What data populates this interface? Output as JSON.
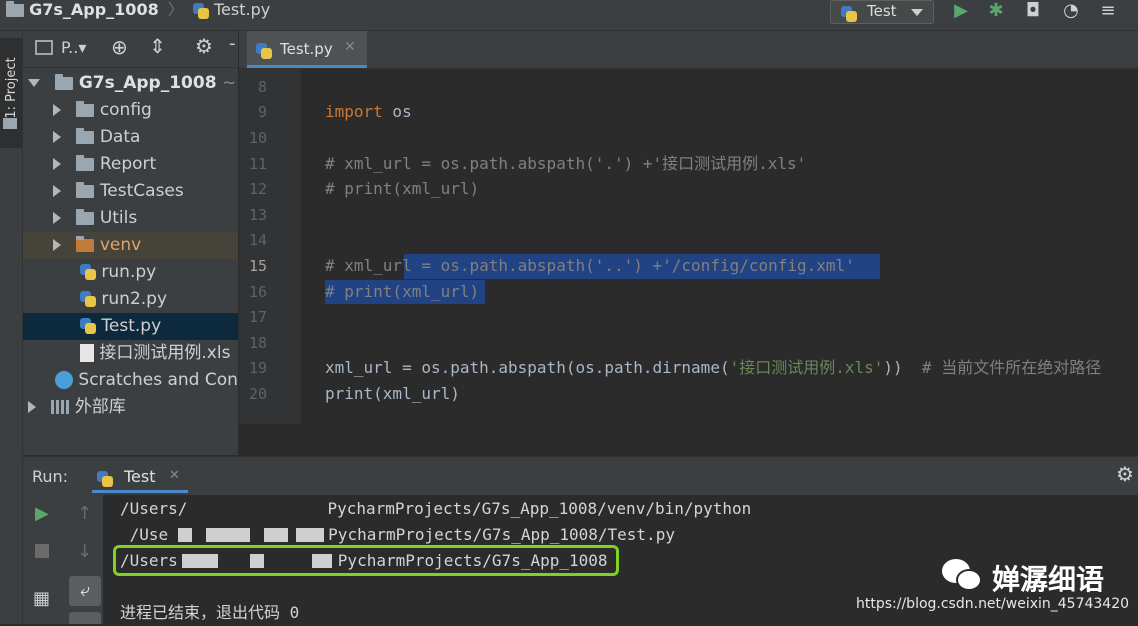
{
  "breadcrumb": {
    "project": "G7s_App_1008",
    "file": "Test.py"
  },
  "toolbar": {
    "run_config": "Test"
  },
  "left_strip": {
    "project_tab": "1: Project"
  },
  "project_panel": {
    "toolbar_label": "P..▾",
    "root": {
      "name": "G7s_App_1008",
      "suffix": "~"
    },
    "items": [
      {
        "name": "config",
        "type": "folder"
      },
      {
        "name": "Data",
        "type": "folder"
      },
      {
        "name": "Report",
        "type": "folder"
      },
      {
        "name": "TestCases",
        "type": "folder"
      },
      {
        "name": "Utils",
        "type": "folder"
      },
      {
        "name": "venv",
        "type": "folder-excluded"
      },
      {
        "name": "run.py",
        "type": "python"
      },
      {
        "name": "run2.py",
        "type": "python"
      },
      {
        "name": "Test.py",
        "type": "python",
        "selected": true
      },
      {
        "name": "接口测试用例.xls",
        "type": "xls"
      }
    ],
    "scratches": "Scratches and Consoles",
    "external_libs": "外部库"
  },
  "editor": {
    "tab_label": "Test.py",
    "lines": [
      {
        "num": "8",
        "text": ""
      },
      {
        "num": "9",
        "text": "import os"
      },
      {
        "num": "10",
        "text": ""
      },
      {
        "num": "11",
        "text": "# xml_url = os.path.abspath('.') +'接口测试用例.xls'"
      },
      {
        "num": "12",
        "text": "# print(xml_url)"
      },
      {
        "num": "13",
        "text": ""
      },
      {
        "num": "14",
        "text": ""
      },
      {
        "num": "15",
        "text": "# xml_url = os.path.abspath('..') +'/config/config.xml'"
      },
      {
        "num": "16",
        "text": "# print(xml_url)"
      },
      {
        "num": "17",
        "text": ""
      },
      {
        "num": "18",
        "text": ""
      },
      {
        "num": "19",
        "text_a": "xml_url = os.path.abspath(os.path.dirname(",
        "text_b": "'接口测试用例.xls'",
        "text_c": "))  ",
        "text_d": "# 当前文件所在绝对路径"
      },
      {
        "num": "20",
        "text": "print(xml_url)"
      }
    ]
  },
  "run_panel": {
    "label": "Run:",
    "tab": "Test",
    "output": [
      {
        "prefix": "/Users/",
        "suffix": "PycharmProjects/G7s_App_1008/venv/bin/python"
      },
      {
        "prefix": " /Use",
        "suffix": "PycharmProjects/G7s_App_1008/Test.py"
      },
      {
        "prefix": "/Users",
        "suffix": "PycharmProjects/G7s_App_1008"
      },
      {
        "prefix": "",
        "suffix": ""
      },
      {
        "prefix": "进程已结束，退出代码 0",
        "suffix": ""
      }
    ]
  },
  "watermark": {
    "brand": "婵潺细语",
    "url": "https://blog.csdn.net/weixin_45743420"
  },
  "colors": {
    "accent": "#4a88c7",
    "highlight_box": "#7ed321",
    "selection": "#214283",
    "keyword": "#cc7832",
    "string": "#6a8759",
    "comment": "#808080"
  }
}
